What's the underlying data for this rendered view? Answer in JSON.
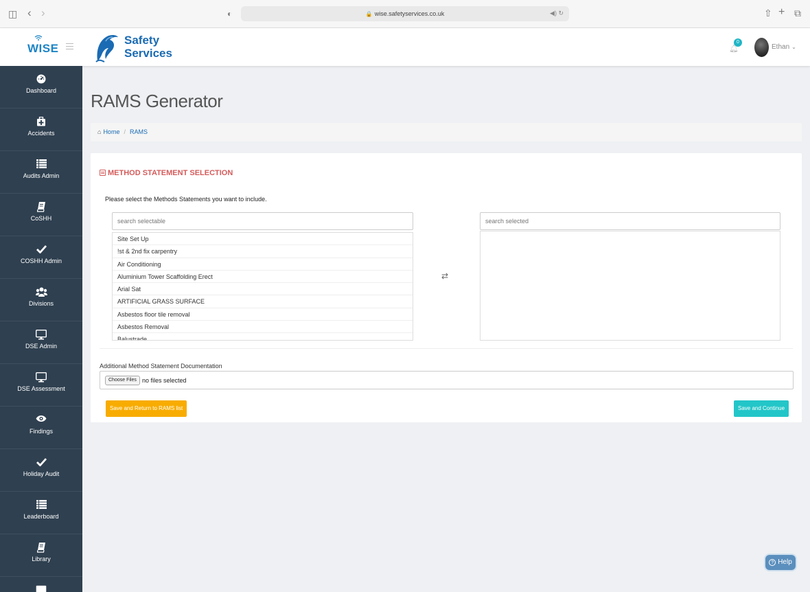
{
  "browser": {
    "url": "wise.safetyservices.co.uk",
    "lock_glyph": "🔒",
    "sidebar_toggle_glyph": "◫",
    "back_glyph": "‹",
    "forward_glyph": "›",
    "shield_glyph": "◐",
    "sound_reload_glyph": "◀) ↻",
    "share_glyph": "⇧",
    "new_tab_glyph": "+",
    "tabs_glyph": "⧉"
  },
  "header": {
    "app_logo": "WISE",
    "brand_line1": "Safety",
    "brand_line2": "Services",
    "notification_count": "0",
    "user_name": "Ethan",
    "user_chevron": "⌄"
  },
  "sidebar": {
    "items": [
      {
        "label": "Dashboard",
        "icon": "dashboard-icon"
      },
      {
        "label": "Accidents",
        "icon": "medkit-icon"
      },
      {
        "label": "Audits Admin",
        "icon": "list-icon"
      },
      {
        "label": "CoSHH",
        "icon": "book-icon"
      },
      {
        "label": "COSHH Admin",
        "icon": "check-icon"
      },
      {
        "label": "Divisions",
        "icon": "users-icon"
      },
      {
        "label": "DSE Admin",
        "icon": "desktop-icon"
      },
      {
        "label": "DSE Assessment",
        "icon": "desktop-icon"
      },
      {
        "label": "Findings",
        "icon": "eye-icon"
      },
      {
        "label": "Holiday Audit",
        "icon": "check-icon"
      },
      {
        "label": "Leaderboard",
        "icon": "list-icon"
      },
      {
        "label": "Library",
        "icon": "book-icon"
      }
    ]
  },
  "page": {
    "title": "RAMS Generator",
    "breadcrumb_home_glyph": "⌂",
    "breadcrumb_home": "Home",
    "breadcrumb_sep": "/",
    "breadcrumb_current": "RAMS"
  },
  "method_statement": {
    "section_title": "METHOD STATEMENT SELECTION",
    "instruction": "Please select the Methods Statements you want to include.",
    "search_selectable_placeholder": "search selectable",
    "search_selected_placeholder": "search selected",
    "swap_glyph": "⇄",
    "selectable_items": [
      "Site Set Up",
      "!st & 2nd fix carpentry",
      "Air Conditioning",
      "Aluminium Tower Scaffolding Erect",
      "Arial Sat",
      "ARTIFICIAL GRASS SURFACE",
      "Asbestos floor tile removal",
      "Asbestos Removal",
      "Balustrade"
    ],
    "selected_items": []
  },
  "documentation": {
    "label": "Additional Method Statement Documentation",
    "choose_files_label": "Choose Files",
    "file_status": "no files selected"
  },
  "actions": {
    "save_return_label": "Save and Return to RAMS list",
    "save_continue_label": "Save and Continue"
  },
  "help": {
    "glyph": "?",
    "label": "Help"
  },
  "colors": {
    "sidebar_bg": "#2f4050",
    "accent_blue": "#1a6bb3",
    "section_title_red": "#d45b5b",
    "btn_warning": "#f8ac00",
    "btn_info": "#23c6c8"
  }
}
